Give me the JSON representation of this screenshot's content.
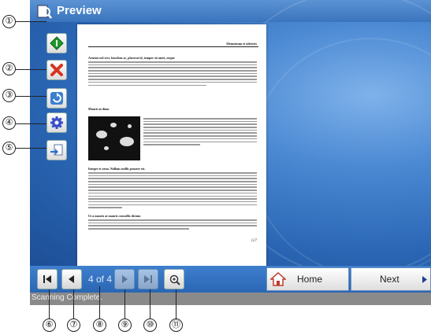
{
  "window": {
    "title": "Preview"
  },
  "toolbar": {
    "buttons": [
      {
        "icon": "green-diamond-icon"
      },
      {
        "icon": "red-x-icon"
      },
      {
        "icon": "rotate-icon"
      },
      {
        "icon": "gear-icon"
      },
      {
        "icon": "page-export-icon"
      }
    ]
  },
  "document": {
    "header": "Elementum et ultricies",
    "heading1": "Aenean sed orci, faucibus ac, placerat id, tempor sit amet, neque",
    "heading2": "Mauris in diam",
    "heading3": "Integer et urna. Nullam mollis posuere est.",
    "heading4": "Ut a mauris at mauris convallis dictum",
    "page_number": "127"
  },
  "navigation": {
    "page_counter": "4 of 4",
    "home_label": "Home",
    "next_label": "Next"
  },
  "status": {
    "text": "Scanning Complete."
  },
  "callouts": [
    "①",
    "②",
    "③",
    "④",
    "⑤",
    "⑥",
    "⑦",
    "⑧",
    "⑨",
    "⑩",
    "⑪"
  ]
}
